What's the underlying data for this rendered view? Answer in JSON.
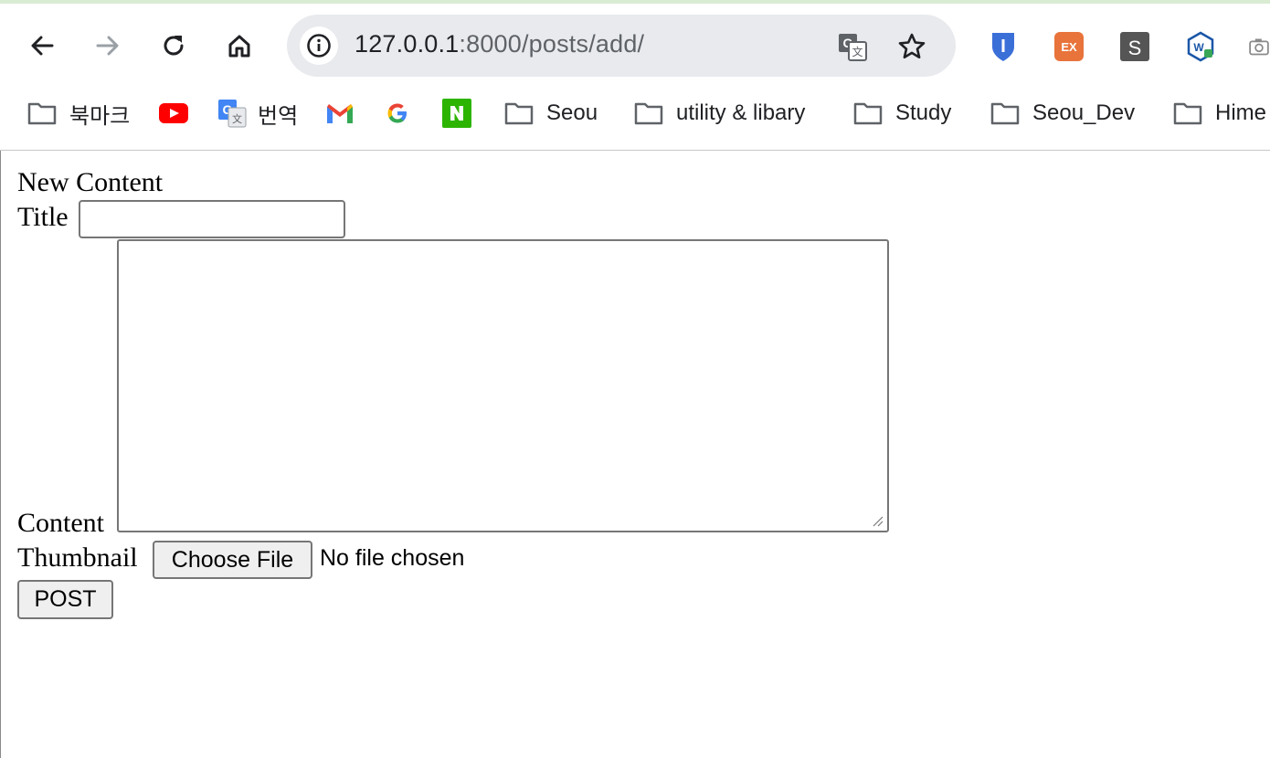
{
  "browser": {
    "address": {
      "host": "127.0.0.1",
      "rest": ":8000/posts/add/"
    },
    "bookmarks": [
      {
        "label": "북마크",
        "icon": "folder-icon"
      },
      {
        "label": "",
        "icon": "youtube-icon"
      },
      {
        "label": "번역",
        "icon": "google-translate-icon"
      },
      {
        "label": "",
        "icon": "gmail-icon"
      },
      {
        "label": "",
        "icon": "google-icon"
      },
      {
        "label": "",
        "icon": "naver-icon"
      },
      {
        "label": "Seou",
        "icon": "folder-icon"
      },
      {
        "label": "utility & libary",
        "icon": "folder-icon"
      },
      {
        "label": "Study",
        "icon": "folder-icon"
      },
      {
        "label": "Seou_Dev",
        "icon": "folder-icon"
      },
      {
        "label": "Hime",
        "icon": "folder-icon"
      }
    ],
    "extensions": [
      {
        "icon": "bitwarden-shield-icon",
        "color": "#3b6fd8"
      },
      {
        "icon": "ex-extension-icon",
        "label": "EX",
        "color": "#e8743b"
      },
      {
        "icon": "s-extension-icon",
        "label": "S",
        "color": "#555555"
      },
      {
        "icon": "w-extension-icon",
        "label": "W",
        "color": "#1a56a8"
      },
      {
        "icon": "camera-icon"
      }
    ]
  },
  "form": {
    "heading": "New Content",
    "title_label": "Title",
    "title_value": "",
    "content_label": "Content",
    "content_value": "",
    "thumbnail_label": "Thumbnail",
    "file_button": "Choose File",
    "file_status": "No file chosen",
    "submit": "POST"
  }
}
